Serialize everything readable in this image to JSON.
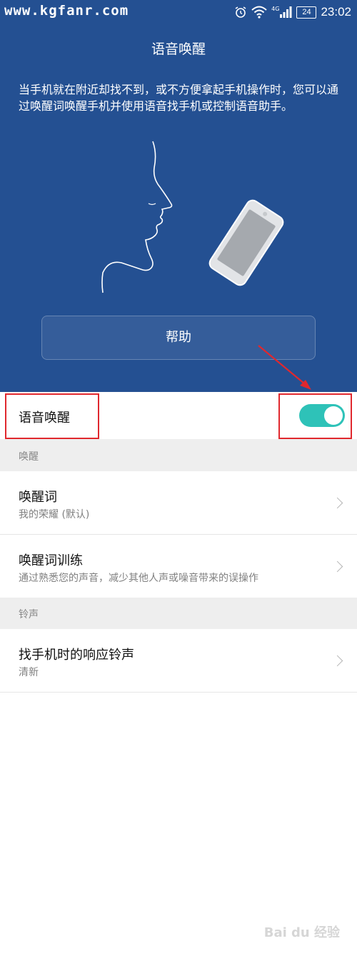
{
  "status_bar": {
    "watermark": "www.kgfanr.com",
    "time": "23:02",
    "battery": "24",
    "network": "4G"
  },
  "header": {
    "title": "语音唤醒",
    "description": "当手机就在附近却找不到，或不方便拿起手机操作时，您可以通过唤醒词唤醒手机并使用语音找手机或控制语音助手。",
    "help_button": "帮助"
  },
  "voice_wake": {
    "label": "语音唤醒",
    "enabled": true
  },
  "sections": {
    "wake": "唤醒",
    "ringtone": "铃声"
  },
  "items": {
    "wake_word": {
      "title": "唤醒词",
      "subtitle": "我的荣耀 (默认)"
    },
    "wake_training": {
      "title": "唤醒词训练",
      "subtitle": "通过熟悉您的声音，减少其他人声或噪音带来的误操作"
    },
    "find_ringtone": {
      "title": "找手机时的响应铃声",
      "subtitle": "清新"
    }
  },
  "bottom_watermark": "Bai du 经验",
  "colors": {
    "header_bg": "#245092",
    "toggle_on": "#2ec2b8",
    "highlight": "#e0282e"
  }
}
